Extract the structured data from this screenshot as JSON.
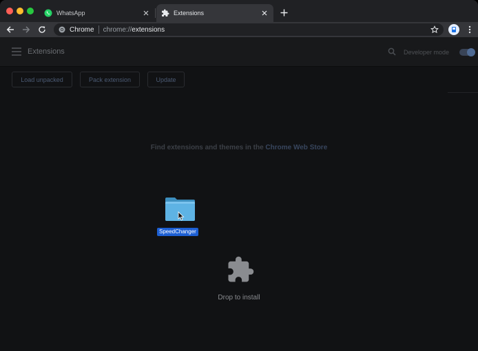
{
  "browser": {
    "tabs": [
      {
        "title": "WhatsApp",
        "favicon": "whatsapp-icon",
        "active": false
      },
      {
        "title": "Extensions",
        "favicon": "puzzle-icon",
        "active": true
      }
    ],
    "address": {
      "chip": "Chrome",
      "scheme": "chrome://",
      "path": "extensions"
    },
    "colors": {
      "red": "#ff5f57",
      "yellow": "#febc2e",
      "green": "#28c840",
      "whatsapp": "#25d366"
    }
  },
  "extensions_page": {
    "title": "Extensions",
    "developer_mode_label": "Developer mode",
    "developer_mode_on": true,
    "actions": {
      "load_unpacked": "Load unpacked",
      "pack_extension": "Pack extension",
      "update": "Update"
    },
    "store_prompt": "Find extensions and themes in the",
    "store_link": "Chrome Web Store",
    "drop_text": "Drop to install"
  },
  "drag": {
    "folder_name": "SpeedChanger",
    "icon": "folder-icon"
  }
}
